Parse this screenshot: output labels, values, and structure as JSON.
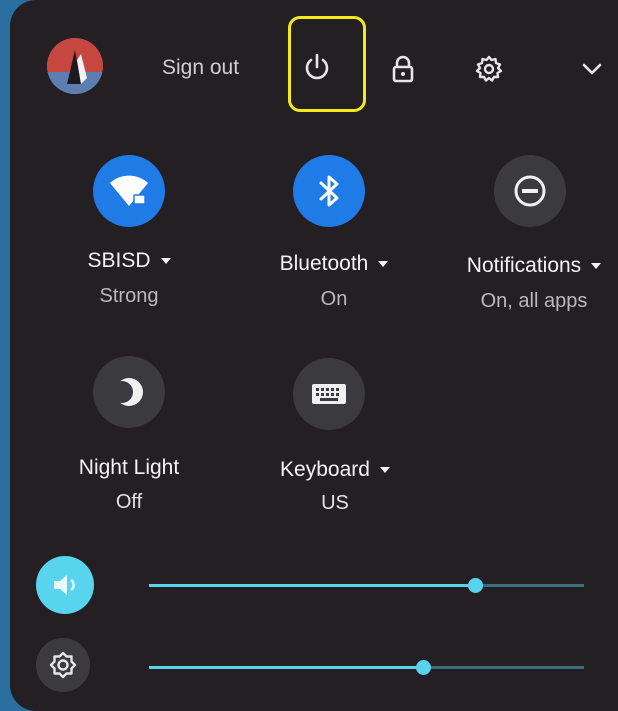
{
  "header": {
    "sign_out_label": "Sign out",
    "icons": [
      "power-icon",
      "lock-icon",
      "settings-gear-icon",
      "chevron-down-icon"
    ]
  },
  "tiles": [
    {
      "id": "wifi",
      "label": "SBISD",
      "sub": "Strong",
      "state": "on",
      "icon": "wifi-icon",
      "has_menu": true
    },
    {
      "id": "bluetooth",
      "label": "Bluetooth",
      "sub": "On",
      "state": "on",
      "icon": "bluetooth-icon",
      "has_menu": true
    },
    {
      "id": "notifications",
      "label": "Notifications",
      "sub": "On, all apps",
      "state": "off",
      "icon": "do-not-disturb-icon",
      "has_menu": true
    },
    {
      "id": "night_light",
      "label": "Night Light",
      "sub": "Off",
      "state": "off",
      "icon": "moon-icon",
      "has_menu": false
    },
    {
      "id": "keyboard",
      "label": "Keyboard",
      "sub": "US",
      "state": "off",
      "icon": "keyboard-icon",
      "has_menu": true
    }
  ],
  "sliders": {
    "volume": {
      "level": 0.75,
      "icon": "volume-icon"
    },
    "brightness": {
      "level": 0.63,
      "icon": "brightness-icon"
    }
  },
  "colors": {
    "accent": "#1f7be6",
    "slider": "#59d4ee",
    "highlight": "#f2ea1d",
    "panel": "#231f22"
  }
}
